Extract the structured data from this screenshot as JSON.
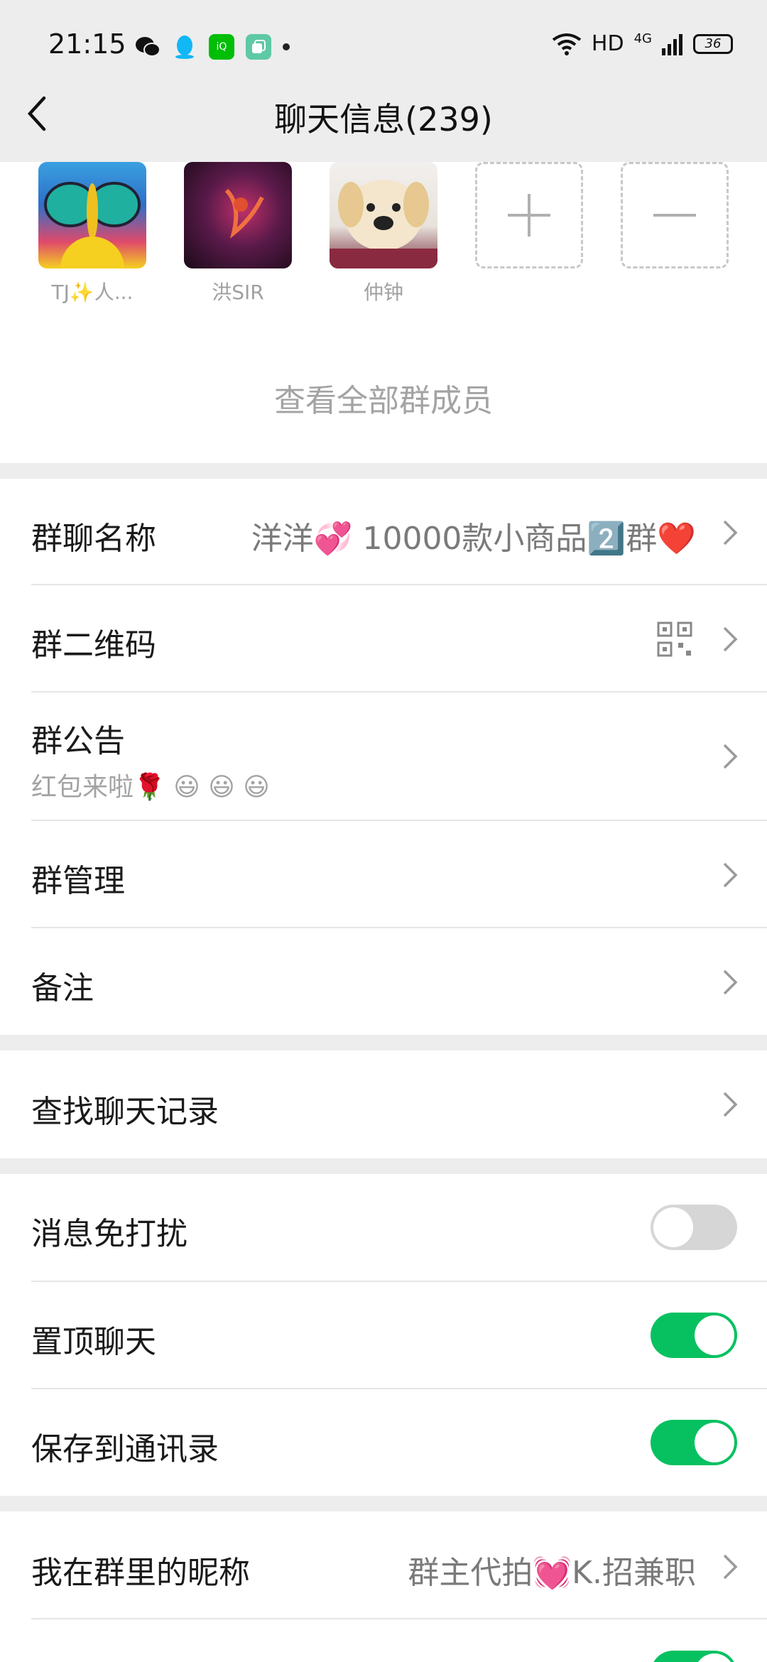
{
  "status_bar": {
    "time": "21:15",
    "network": "HD",
    "cell": "4G",
    "battery": "36",
    "left_icons": [
      "wechat-icon",
      "qq-icon",
      "iqiyi-icon",
      "app-icon",
      "dot-icon"
    ]
  },
  "nav": {
    "title": "聊天信息(239)"
  },
  "members": {
    "items": [
      {
        "name": "TJ✨人..."
      },
      {
        "name": "洪SIR"
      },
      {
        "name": "仲钟"
      }
    ],
    "view_all": "查看全部群成员"
  },
  "settings": {
    "group_name_label": "群聊名称",
    "group_name_value": "洋洋💞 10000款小商品2️⃣群❤️",
    "qr_label": "群二维码",
    "notice_label": "群公告",
    "notice_preview": "红包来啦🌹 😃 😃 😃",
    "manage_label": "群管理",
    "remark_label": "备注",
    "search_label": "查找聊天记录",
    "mute_label": "消息免打扰",
    "mute_on": false,
    "pin_label": "置顶聊天",
    "pin_on": true,
    "save_label": "保存到通讯录",
    "save_on": true,
    "nickname_label": "我在群里的昵称",
    "nickname_value": "群主代拍💓K.招兼职"
  },
  "colors": {
    "toggle_on": "#07c160",
    "toggle_off": "#d6d6d6",
    "background": "#ededed"
  }
}
